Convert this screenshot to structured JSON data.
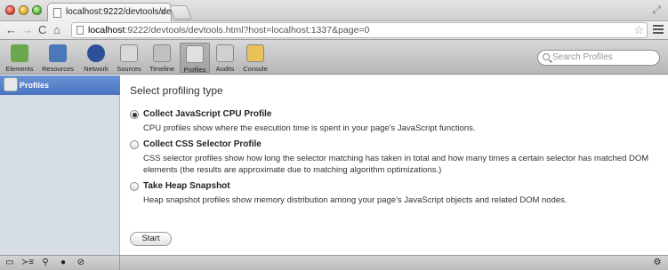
{
  "browser": {
    "tab_title": "localhost:9222/devtools/dev",
    "url_host": "localhost",
    "url_rest": ":9222/devtools/devtools.html?host=localhost:1337&page=0"
  },
  "toolbar": {
    "items": [
      {
        "label": "Elements",
        "color": "#6aa84f"
      },
      {
        "label": "Resources",
        "color": "#4a78b8"
      },
      {
        "label": "Network",
        "color": "#2e4f9a"
      },
      {
        "label": "Sources",
        "color": "#d9d9d9"
      },
      {
        "label": "Timeline",
        "color": "#c0c0c0"
      },
      {
        "label": "Profiles",
        "color": "#e0e0e0"
      },
      {
        "label": "Audits",
        "color": "#d0d0d0"
      },
      {
        "label": "Console",
        "color": "#e8c35a"
      }
    ],
    "selected": "Profiles",
    "search_placeholder": "Search Profiles"
  },
  "sidebar": {
    "items": [
      {
        "label": "Profiles"
      }
    ]
  },
  "main": {
    "heading": "Select profiling type",
    "options": [
      {
        "label": "Collect JavaScript CPU Profile",
        "desc": "CPU profiles show where the execution time is spent in your page's JavaScript functions.",
        "checked": true
      },
      {
        "label": "Collect CSS Selector Profile",
        "desc": "CSS selector profiles show how long the selector matching has taken in total and how many times a certain selector has matched DOM elements (the results are approximate due to matching algorithm optimizations.)",
        "checked": false
      },
      {
        "label": "Take Heap Snapshot",
        "desc": "Heap snapshot profiles show memory distribution among your page's JavaScript objects and related DOM nodes.",
        "checked": false
      }
    ],
    "start_label": "Start"
  }
}
